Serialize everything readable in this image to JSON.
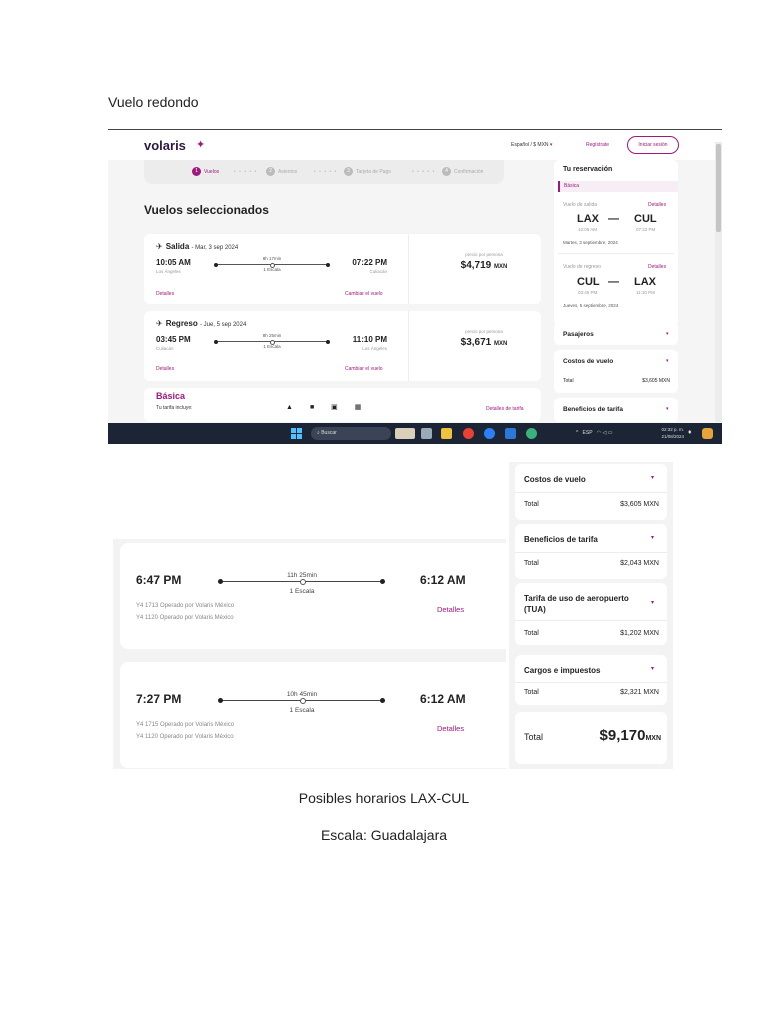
{
  "doc": {
    "heading": "Vuelo redondo",
    "caption_schedules": "Posibles horarios LAX-CUL",
    "caption_stop": "Escala: Guadalajara"
  },
  "shot1": {
    "logo": "volaris",
    "lang_currency": "Español / $ MXN",
    "register": "Regístrate",
    "login": "Iniciar sesión",
    "steps": [
      {
        "num": "1",
        "label": "Vuelos"
      },
      {
        "num": "2",
        "label": "Asientos"
      },
      {
        "num": "3",
        "label": "Tarjeta de Pago"
      },
      {
        "num": "4",
        "label": "Confirmación"
      }
    ],
    "selected_title": "Vuelos seleccionados",
    "outbound": {
      "title": "Salida",
      "date": "- Mar, 3 sep 2024",
      "dep_time": "10:05 AM",
      "dep_city": "Los Ángeles",
      "duration": "8h 17min",
      "stops": "1 Escala",
      "arr_time": "07:22 PM",
      "arr_city": "Culiacán",
      "details": "Detalles",
      "change": "Cambiar el vuelo",
      "per_person": "precio por persona",
      "price": "$4,719",
      "currency": "MXN"
    },
    "return": {
      "title": "Regreso",
      "date": "- Jue, 5 sep 2024",
      "dep_time": "03:45 PM",
      "dep_city": "Culiacán",
      "duration": "8h 25min",
      "stops": "1 Escala",
      "arr_time": "11:10 PM",
      "arr_city": "Los Ángeles",
      "details": "Detalles",
      "change": "Cambiar el vuelo",
      "per_person": "precio por persona",
      "price": "$3,671",
      "currency": "MXN"
    },
    "fare": {
      "name": "Básica",
      "includes": "Tu tarifa incluye:",
      "details": "Detalles de tarifa"
    },
    "reservation": {
      "title": "Tu reservación",
      "fare": "Básica",
      "out_label": "Vuelo de salida",
      "out_details": "Detalles",
      "out_from": "LAX",
      "out_to": "CUL",
      "out_dep": "10:05 AM",
      "out_arr": "07:22 PM",
      "out_date": "Martes, 3 septiembre, 2024",
      "ret_label": "Vuelo de regreso",
      "ret_details": "Detalles",
      "ret_from": "CUL",
      "ret_to": "LAX",
      "ret_dep": "03:45 PM",
      "ret_arr": "11:10 PM",
      "ret_date": "Jueves, 5 septiembre, 2024",
      "dash": "—"
    },
    "accordions": {
      "passengers": "Pasajeros",
      "flight_costs": "Costos de vuelo",
      "total_label": "Total",
      "total_value": "$3,605 MXN",
      "fare_benefits": "Beneficios de tarifa"
    },
    "taskbar": {
      "search": "Buscar",
      "lang": "ESP",
      "time": "02:32 p. m.",
      "date": "21/08/2024"
    }
  },
  "options": [
    {
      "dep": "6:47 PM",
      "arr": "6:12 AM",
      "duration": "11h 25min",
      "stops": "1 Escala",
      "flight1": "Y4 1713 Operado por Volaris México",
      "flight2": "Y4 1120 Operado por Volaris México",
      "details": "Detalles"
    },
    {
      "dep": "7:27 PM",
      "arr": "6:12 AM",
      "duration": "10h 45min",
      "stops": "1 Escala",
      "flight1": "Y4 1715 Operado por Volaris México",
      "flight2": "Y4 1120 Operado por Volaris México",
      "details": "Detalles"
    }
  ],
  "costs": {
    "items": [
      {
        "title": "Costos de vuelo",
        "total_label": "Total",
        "total": "$3,605 MXN"
      },
      {
        "title": "Beneficios de tarifa",
        "total_label": "Total",
        "total": "$2,043 MXN"
      },
      {
        "title": "Tarifa de uso de aeropuerto (TUA)",
        "total_label": "Total",
        "total": "$1,202 MXN"
      },
      {
        "title": "Cargos e impuestos",
        "total_label": "Total",
        "total": "$2,321 MXN"
      }
    ],
    "grand_label": "Total",
    "grand_value": "$9,170",
    "grand_currency": "MXN"
  },
  "colors": {
    "brand": "#a0187e",
    "taskbar": "#1c2536"
  }
}
